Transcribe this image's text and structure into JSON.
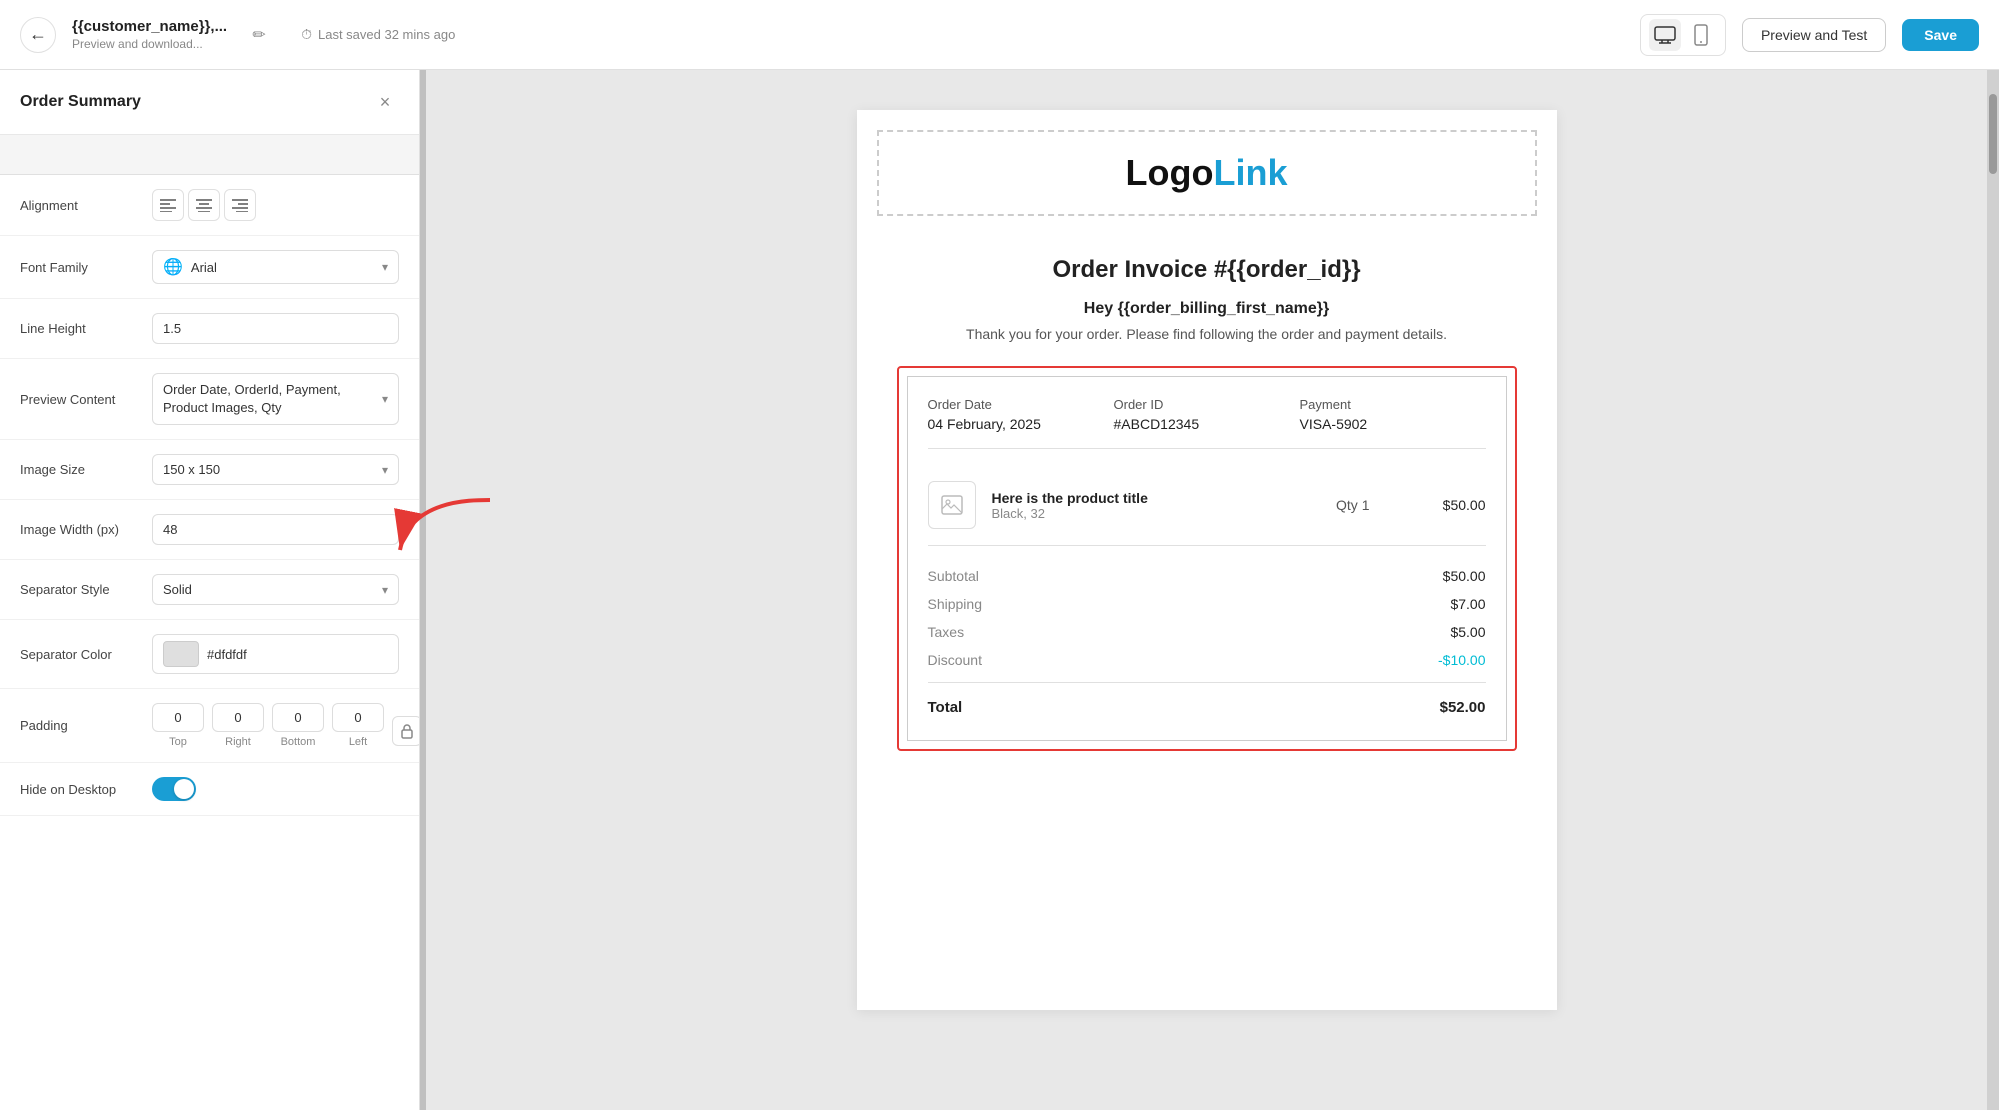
{
  "topbar": {
    "back_label": "←",
    "title_main": "{{customer_name}},...",
    "title_sub": "Preview and download...",
    "edit_icon": "✏",
    "saved_text": "Last saved 32 mins ago",
    "saved_icon": "🕐",
    "desktop_icon": "🖥",
    "mobile_icon": "📱",
    "preview_btn": "Preview and Test",
    "save_btn": "Save"
  },
  "left_panel": {
    "title": "Order Summary",
    "close_icon": "×",
    "rows": {
      "alignment": {
        "label": "Alignment",
        "icons": [
          "≡",
          "⊟",
          "≡"
        ]
      },
      "font_family": {
        "label": "Font Family",
        "globe_icon": "🌐",
        "value": "Arial"
      },
      "line_height": {
        "label": "Line Height",
        "value": "1.5"
      },
      "preview_content": {
        "label": "Preview Content",
        "value": "Order Date, OrderId, Payment, Product Images, Qty"
      },
      "image_size": {
        "label": "Image Size",
        "value": "150 x 150"
      },
      "image_width": {
        "label": "Image Width (px)",
        "value": "48"
      },
      "separator_style": {
        "label": "Separator Style",
        "value": "Solid"
      },
      "separator_color": {
        "label": "Separator Color",
        "value": "#dfdfdf",
        "color": "#dfdfdf"
      },
      "padding": {
        "label": "Padding",
        "top": "0",
        "right": "0",
        "bottom": "0",
        "left": "0",
        "top_label": "Top",
        "right_label": "Right",
        "bottom_label": "Bottom",
        "left_label": "Left"
      },
      "hide_desktop": {
        "label": "Hide on Desktop",
        "enabled": true
      }
    }
  },
  "email": {
    "logo_black": "Logo",
    "logo_blue": "Link",
    "title": "Order Invoice #{{order_id}}",
    "subtitle": "Hey {{order_billing_first_name}}",
    "desc": "Thank you for your order. Please find following the order and payment details.",
    "order": {
      "date_label": "Order Date",
      "date_value": "04 February, 2025",
      "id_label": "Order ID",
      "id_value": "#ABCD12345",
      "payment_label": "Payment",
      "payment_value": "VISA-5902",
      "product_title": "Here is the product title",
      "product_variant": "Black, 32",
      "qty_label": "Qty 1",
      "price": "$50.00",
      "subtotal_label": "Subtotal",
      "subtotal_value": "$50.00",
      "shipping_label": "Shipping",
      "shipping_value": "$7.00",
      "taxes_label": "Taxes",
      "taxes_value": "$5.00",
      "discount_label": "Discount",
      "discount_value": "-$10.00",
      "total_label": "Total",
      "total_value": "$52.00"
    }
  }
}
